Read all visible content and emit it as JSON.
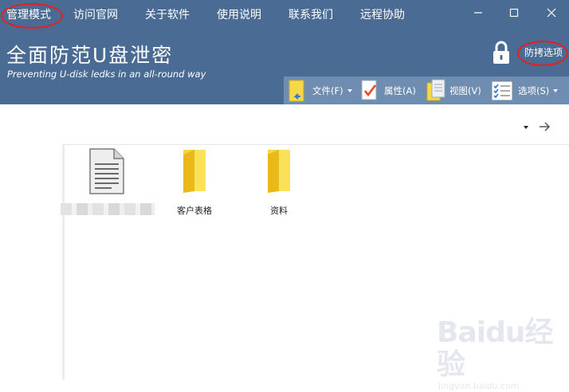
{
  "menu": {
    "admin_mode": "管理模式",
    "official_site": "访问官网",
    "about": "关于软件",
    "usage": "使用说明",
    "contact": "联系我们",
    "remote_help": "远程协助"
  },
  "brand": {
    "title": "全面防范U盘泄密",
    "subtitle": "Preventing U-disk ledks in an all-round way"
  },
  "protect_options": "防拷选项",
  "toolbar": {
    "file": "文件(F)",
    "properties": "属性(A)",
    "view": "视图(V)",
    "options": "选项(S)"
  },
  "files": [
    {
      "name": "",
      "icon": "document-icon"
    },
    {
      "name": "客户表格",
      "icon": "folder-icon"
    },
    {
      "name": "资料",
      "icon": "folder-icon"
    }
  ],
  "watermark": {
    "main": "Baidu经验",
    "sub": "jingyan.baidu.com"
  },
  "colors": {
    "header": "#4a6b93",
    "toolbar": "#6f8db1",
    "highlight_ring": "#e52020",
    "folder": "#f5cf1b"
  }
}
